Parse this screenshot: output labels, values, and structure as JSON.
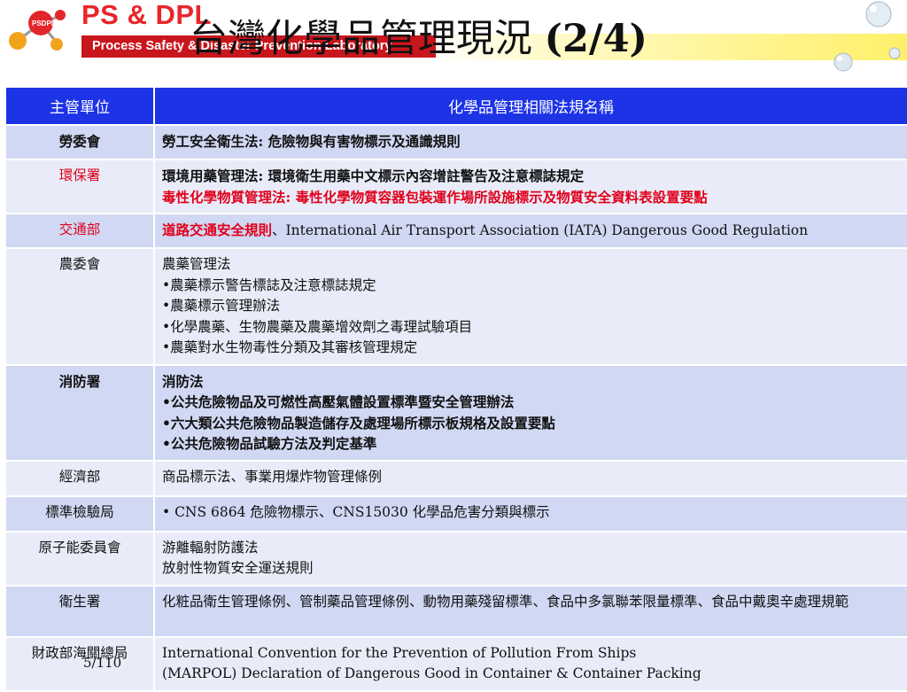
{
  "header": {
    "brand": "PS & DPL",
    "tagline": "Process Safety & Disaster Prevention Laboratory",
    "logo_label": "PSDPL",
    "title_main": "台灣化學品管理現況",
    "title_suffix": "(2/4)"
  },
  "table": {
    "headers": [
      "主管單位",
      "化學品管理相關法規名稱"
    ],
    "rows": [
      {
        "agency": "勞委會",
        "lines": [
          "勞工安全衛生法: 危險物與有害物標示及通識規則"
        ]
      },
      {
        "agency": "環保署",
        "lines": [
          "環境用藥管理法: 環境衛生用藥中文標示內容增註警告及注意標誌規定",
          "毒性化學物質管理法: 毒性化學物質容器包裝運作場所設施標示及物質安全資料表設置要點"
        ]
      },
      {
        "agency": "交通部",
        "red_part": "道路交通安全規則",
        "rest": "、International Air Transport Association (IATA) Dangerous Good Regulation"
      },
      {
        "agency": "農委會",
        "lines": [
          "農藥管理法",
          "•農藥標示警告標誌及注意標誌規定",
          "•農藥標示管理辦法",
          "•化學農藥、生物農藥及農藥增效劑之毒理試驗項目",
          "•農藥對水生物毒性分類及其審核管理規定"
        ]
      },
      {
        "agency": "消防署",
        "lines": [
          "消防法",
          "•公共危險物品及可燃性高壓氣體設置標準暨安全管理辦法",
          "•六大類公共危險物品製造儲存及處理場所標示板規格及設置要點",
          "•公共危險物品試驗方法及判定基準"
        ]
      },
      {
        "agency": "經濟部",
        "lines": [
          "商品標示法、事業用爆炸物管理條例"
        ]
      },
      {
        "agency": "標準檢驗局",
        "lines": [
          "•  CNS 6864 危險物標示、CNS15030 化學品危害分類與標示"
        ]
      },
      {
        "agency": "原子能委員會",
        "lines": [
          "游離輻射防護法",
          "放射性物質安全運送規則"
        ]
      },
      {
        "agency": "衛生署",
        "lines": [
          "化粧品衛生管理條例、管制藥品管理條例、動物用藥殘留標準、食品中多氯聯苯限量標準、食品中戴奧辛處理規範"
        ]
      },
      {
        "agency": "財政部海關總局",
        "lines": [
          "International Convention for the Prevention of Pollution From Ships",
          "(MARPOL) Declaration of Dangerous Good in Container & Container Packing"
        ]
      }
    ]
  },
  "footer": {
    "page": "5/110"
  },
  "colors": {
    "header_row": "#1d33e6",
    "row_dark": "#d0d8f3",
    "row_light": "#e9ecf8",
    "red_text": "#e0001b",
    "brand_red": "#e8262a",
    "tagline_bg": "#c8161d"
  }
}
